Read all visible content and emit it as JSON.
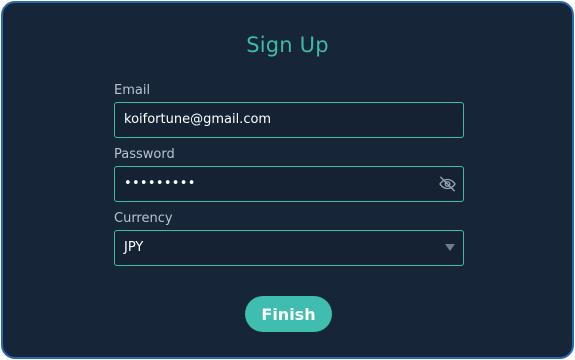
{
  "form": {
    "title": "Sign Up",
    "email": {
      "label": "Email",
      "value": "koifortune@gmail.com"
    },
    "password": {
      "label": "Password",
      "masked_value": "•••••••••",
      "visibility_icon": "eye-slash-icon"
    },
    "currency": {
      "label": "Currency",
      "selected": "JPY",
      "dropdown_icon": "chevron-down-icon"
    },
    "submit_label": "Finish"
  },
  "colors": {
    "card_background": "#172539",
    "card_border": "#2a68b4",
    "accent": "#3cbba6",
    "button": "#3fbdae",
    "label": "#b8c2cf",
    "text": "#ffffff"
  }
}
